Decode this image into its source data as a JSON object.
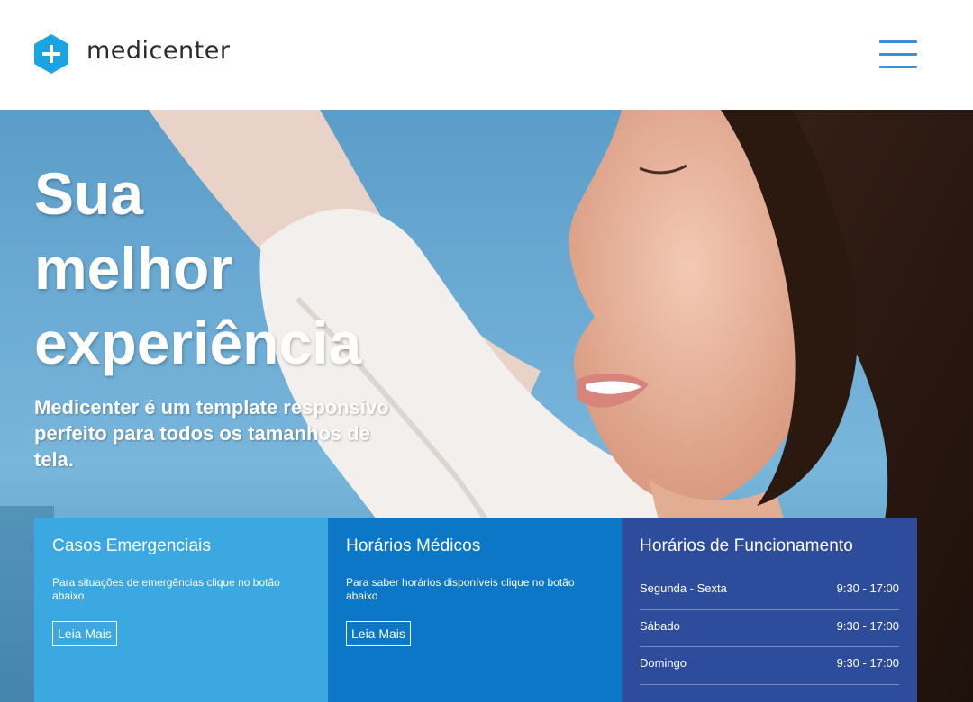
{
  "header": {
    "brand": "medicenter",
    "logo_icon": "medical-cross-hexagon-icon",
    "menu_icon": "hamburger-menu-icon",
    "accent_color": "#1ba4e2"
  },
  "hero": {
    "title_lines": [
      "Sua",
      "melhor",
      "experiência"
    ],
    "subtitle": "Medicenter é um template responsivo perfeito para todos os tamanhos de tela."
  },
  "boxes": [
    {
      "title": "Casos Emergenciais",
      "text": "Para situações de emergências clique no botão abaixo",
      "button": "Leia Mais",
      "color": "#3ca8e2"
    },
    {
      "title": "Horários Médicos",
      "text": "Para saber horários disponíveis clique no botão abaixo",
      "button": "Leia Mais",
      "color": "#0b77c6"
    },
    {
      "title": "Horários de Funcionamento",
      "color": "#2d4c9b",
      "hours": [
        {
          "day": "Segunda - Sexta",
          "time": "9:30 - 17:00"
        },
        {
          "day": "Sábado",
          "time": "9:30 - 17:00"
        },
        {
          "day": "Domingo",
          "time": "9:30 - 17:00"
        }
      ]
    }
  ]
}
